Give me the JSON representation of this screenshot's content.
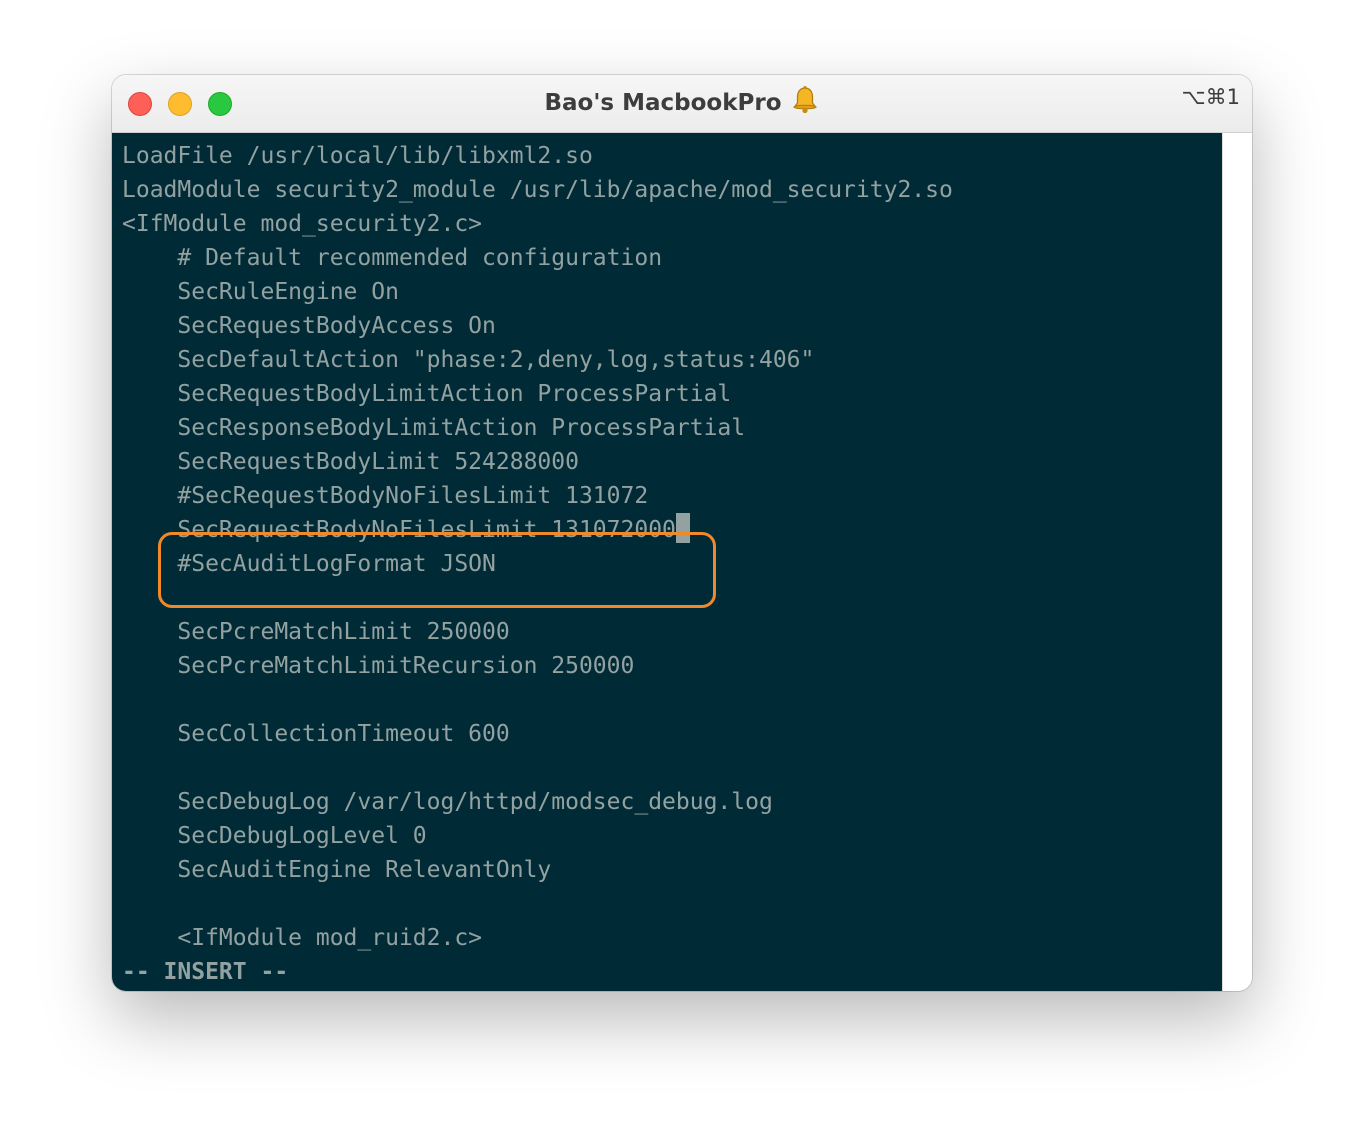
{
  "window": {
    "title": "Bao's MacbookPro",
    "shortcut": "⌥⌘1",
    "title_icon": "bell-icon"
  },
  "colors": {
    "terminal_bg": "#002b36",
    "terminal_fg": "#93a1a1",
    "highlight_border": "#f0892a",
    "close": "#fe5f57",
    "minimize": "#febc2e",
    "zoom": "#28c840"
  },
  "terminal": {
    "lines": [
      "LoadFile /usr/local/lib/libxml2.so",
      "LoadModule security2_module /usr/lib/apache/mod_security2.so",
      "<IfModule mod_security2.c>",
      "    # Default recommended configuration",
      "    SecRuleEngine On",
      "    SecRequestBodyAccess On",
      "    SecDefaultAction \"phase:2,deny,log,status:406\"",
      "    SecRequestBodyLimitAction ProcessPartial",
      "    SecResponseBodyLimitAction ProcessPartial",
      "    SecRequestBodyLimit 524288000",
      "    #SecRequestBodyNoFilesLimit 131072",
      "    SecRequestBodyNoFilesLimit 131072000",
      "    #SecAuditLogFormat JSON",
      "",
      "    SecPcreMatchLimit 250000",
      "    SecPcreMatchLimitRecursion 250000",
      "",
      "    SecCollectionTimeout 600",
      "",
      "    SecDebugLog /var/log/httpd/modsec_debug.log",
      "    SecDebugLogLevel 0",
      "    SecAuditEngine RelevantOnly",
      "",
      "    <IfModule mod_ruid2.c>"
    ],
    "mode": "-- INSERT --"
  }
}
